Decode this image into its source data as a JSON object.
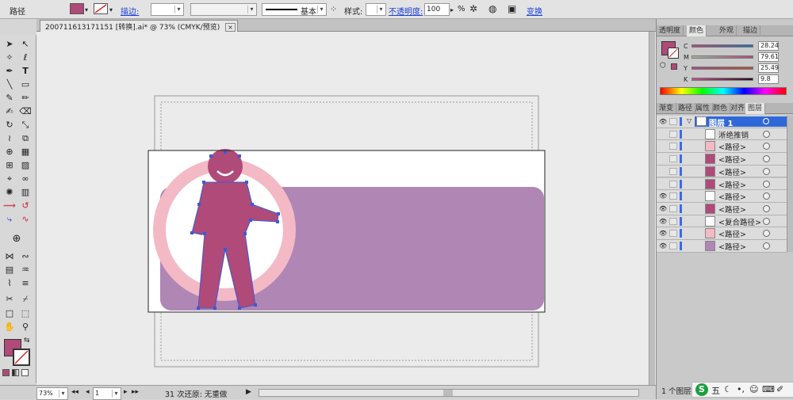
{
  "control_bar": {
    "selection_label": "路径",
    "fill_color": "#b04a78",
    "stroke_label": "描边:",
    "stroke_profile": "基本",
    "style_label": "样式:",
    "opacity_label": "不透明度:",
    "opacity_value": "100",
    "opacity_unit": "%",
    "transform_label": "变换"
  },
  "document_tab": {
    "title": "200711613171151 [转换].ai* @ 73% (CMYK/预览)",
    "close_glyph": "×"
  },
  "status_bar": {
    "zoom": "73%",
    "artboard": "1",
    "undo_status": "31 次还原: 无重做"
  },
  "color_panel": {
    "tabs": [
      "透明度",
      "颜色",
      "外观",
      "描边"
    ],
    "active_tab": "颜色",
    "channels": [
      {
        "label": "C",
        "value": "28.24"
      },
      {
        "label": "M",
        "value": "79.61"
      },
      {
        "label": "Y",
        "value": "25.49"
      },
      {
        "label": "K",
        "value": "9.8"
      }
    ],
    "fill_color": "#b04a78"
  },
  "layers_panel": {
    "tabs": [
      "渐变",
      "路径",
      "属性",
      "颜色",
      "对齐",
      "图层"
    ],
    "active_tab": "图层",
    "layer_name": "图层 1",
    "items": [
      {
        "name": "淅绝推销",
        "eye": false
      },
      {
        "name": "<路径>",
        "eye": false
      },
      {
        "name": "<路径>",
        "eye": false
      },
      {
        "name": "<路径>",
        "eye": false
      },
      {
        "name": "<路径>",
        "eye": false
      },
      {
        "name": "<路径>",
        "eye": true
      },
      {
        "name": "<路径>",
        "eye": true
      },
      {
        "name": "<复合路径>",
        "eye": true
      },
      {
        "name": "<路径>",
        "eye": true
      },
      {
        "name": "<路径>",
        "eye": true
      }
    ],
    "footer_count": "1 个图层"
  },
  "taskbar": {
    "ime_label": "五"
  },
  "artwork_colors": {
    "ring": "#f3b9c5",
    "figure": "#b04a78",
    "banner": "#b086b5",
    "anchor": "#3a5ad8"
  }
}
